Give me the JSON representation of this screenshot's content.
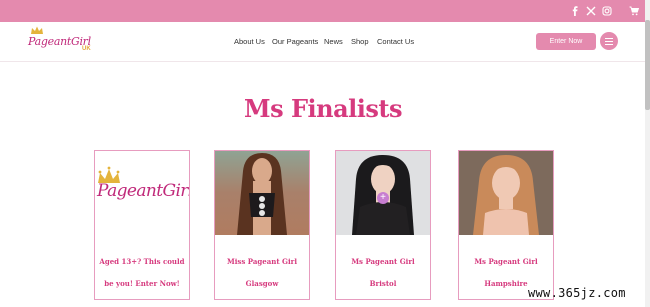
{
  "topbar": {
    "icons": [
      "facebook-icon",
      "x-icon",
      "instagram-icon",
      "cart-icon"
    ],
    "color": "#e48aae"
  },
  "logo": {
    "text": "PageantGirl",
    "suffix": "UK"
  },
  "nav": {
    "items": [
      "About Us",
      "Our Pageants",
      "News",
      "Shop",
      "Contact Us"
    ]
  },
  "header": {
    "enter_label": "Enter Now"
  },
  "main": {
    "title": "Ms Finalists"
  },
  "cards": [
    {
      "logo_text": "PageantGirl",
      "line1": "Aged 13+? This could",
      "line2": "be you! Enter Now!"
    },
    {
      "line1": "Miss Pageant Girl",
      "line2": "Glasgow"
    },
    {
      "line1": "Ms Pageant Girl",
      "line2": "Bristol"
    },
    {
      "line1": "Ms Pageant Girl",
      "line2": "Hampshire"
    }
  ],
  "accent": "#d63a7e",
  "watermark": "www.365jz.com"
}
